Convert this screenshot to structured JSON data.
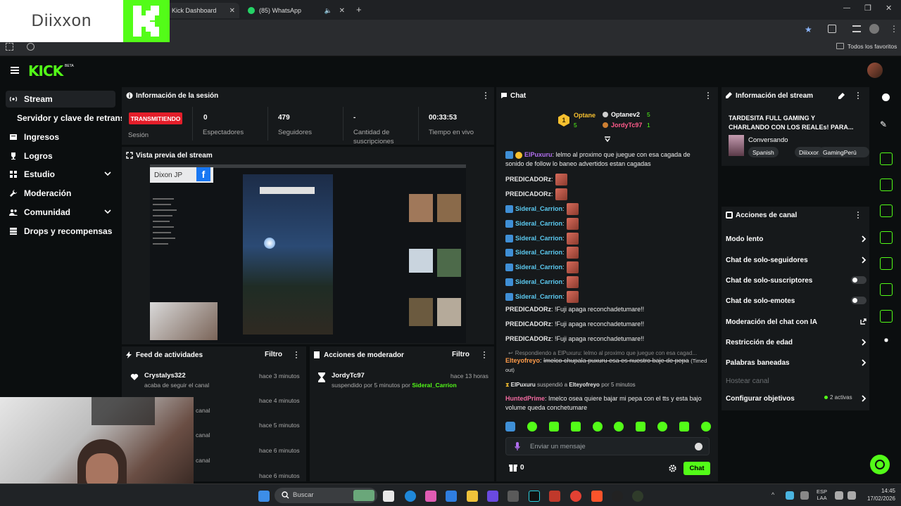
{
  "browser": {
    "tabs": [
      {
        "label": "Kick Dashboard"
      },
      {
        "label": "(85) WhatsApp"
      }
    ],
    "bookmarks_label": "Todos los favoritos"
  },
  "overlay_logo": {
    "text": "Diixxon"
  },
  "kick": {
    "logo": "KICK",
    "logo_sup": "BETA"
  },
  "sidebar": {
    "items": [
      {
        "label": "Stream",
        "icon": "stream-icon"
      },
      {
        "label": "Servidor y clave de retransm"
      },
      {
        "label": "Ingresos",
        "icon": "revenue-icon"
      },
      {
        "label": "Logros",
        "icon": "trophy-icon"
      },
      {
        "label": "Estudio",
        "icon": "studio-icon"
      },
      {
        "label": "Moderación",
        "icon": "wrench-icon"
      },
      {
        "label": "Comunidad",
        "icon": "community-icon"
      },
      {
        "label": "Drops y recompensas",
        "icon": "drops-icon"
      }
    ]
  },
  "session": {
    "title": "Información de la sesión",
    "live_badge": "TRANSMITIENDO",
    "session_label": "Sesión",
    "stats": [
      {
        "value": "0",
        "label": "Espectadores"
      },
      {
        "value": "479",
        "label": "Seguidores"
      },
      {
        "value": "-",
        "label": "Cantidad de suscripciones"
      },
      {
        "value": "00:33:53",
        "label": "Tiempo en vivo"
      }
    ]
  },
  "preview": {
    "title": "Vista previa del stream",
    "overlay_text": "Dixon JP"
  },
  "activity_feed": {
    "title": "Feed de actividades",
    "filter": "Filtro",
    "items": [
      {
        "user": "Crystalys322",
        "action": "acaba de seguir el canal",
        "time": "hace 3 minutos"
      },
      {
        "action": "canal",
        "time": "hace 4 minutos"
      },
      {
        "action": "canal",
        "time": "hace 5 minutos"
      },
      {
        "action": "canal",
        "time": "hace 6 minutos"
      },
      {
        "action": "canal",
        "time": "hace 6 minutos"
      }
    ]
  },
  "mod_actions": {
    "title": "Acciones de moderador",
    "filter": "Filtro",
    "items": [
      {
        "user": "JordyTc97",
        "time": "hace 13 horas",
        "action": "suspendido por 5 minutos por",
        "target": "Sideral_Carrion"
      }
    ]
  },
  "chat": {
    "title": "Chat",
    "leaderboard": [
      {
        "rank": "1",
        "user": "Optane",
        "count": "5"
      },
      {
        "user": "Optanev2",
        "count": "5"
      },
      {
        "user": "JordyTc97",
        "count": "1"
      }
    ],
    "messages": [
      {
        "user": "ElPuxuru",
        "text": "lelmo al proximo que juegue con esa cagada de sonido de follow lo baneo advertidos estan cagadas"
      },
      {
        "user": "PREDICADORz",
        "text": ""
      },
      {
        "user": "PREDICADORz",
        "text": ""
      },
      {
        "user": "Sideral_Carrion",
        "text": ""
      },
      {
        "user": "Sideral_Carrion",
        "text": ""
      },
      {
        "user": "Sideral_Carrion",
        "text": ""
      },
      {
        "user": "Sideral_Carrion",
        "text": ""
      },
      {
        "user": "Sideral_Carrion",
        "text": ""
      },
      {
        "user": "Sideral_Carrion",
        "text": ""
      },
      {
        "user": "Sideral_Carrion",
        "text": ""
      },
      {
        "user": "PREDICADORz",
        "text": "!Fuji apaga reconchadetumare!!"
      },
      {
        "user": "PREDICADORz",
        "text": "!Fuji apaga reconchadetumare!!"
      },
      {
        "user": "PREDICADORz",
        "text": "!Fuji apaga reconchadetumare!!"
      }
    ],
    "reply_preview": "Respondiendo a ElPuxuru: lelmo al proximo que juegue con esa cagad...",
    "deleted_user": "Elteyofreyo",
    "deleted_text": "Imelco chupala puxuru esa es nuestro baje de pepa",
    "timed_out": "(Timed out)",
    "suspension": {
      "mod": "ElPuxuru",
      "verb": "suspendió a",
      "target": "Elteyofreyo",
      "duration": "por 5 minutos"
    },
    "last_user": "HuntedPrime",
    "last_text": "Imelco osea quiere bajar mi pepa con el tts y esta bajo volume queda conchetumare",
    "input_placeholder": "Enviar un mensaje",
    "points": "0",
    "send_label": "Chat"
  },
  "stream_info": {
    "title": "Información del stream",
    "stream_title": "TARDESITA FULL GAMING Y CHARLANDO CON LOS REALEs! PARA...",
    "category": "Conversando",
    "tags": [
      "Spanish",
      "Diiixxon",
      "GamingPerú"
    ]
  },
  "channel_actions": {
    "title": "Acciones de canal",
    "rows": [
      {
        "label": "Modo lento",
        "type": "chevron"
      },
      {
        "label": "Chat de solo-seguidores",
        "type": "chevron"
      },
      {
        "label": "Chat de solo-suscriptores",
        "type": "toggle"
      },
      {
        "label": "Chat de solo-emotes",
        "type": "toggle"
      },
      {
        "label": "Moderación del chat con IA",
        "type": "external"
      },
      {
        "label": "Restricción de edad",
        "type": "chevron"
      },
      {
        "label": "Palabras baneadas",
        "type": "chevron"
      },
      {
        "label": "Hostear canal",
        "type": "disabled"
      },
      {
        "label": "Configurar objetivos",
        "type": "chevron",
        "extra": "2 activas"
      }
    ]
  },
  "taskbar": {
    "search_placeholder": "Buscar",
    "lang_line1": "ESP",
    "lang_line2": "LAA",
    "time": "14:45",
    "date": "17/02/2026"
  },
  "colors": {
    "accent": "#53fc18",
    "live": "#e41e2a",
    "panel": "#16191b",
    "bg": "#0b0e0f"
  }
}
